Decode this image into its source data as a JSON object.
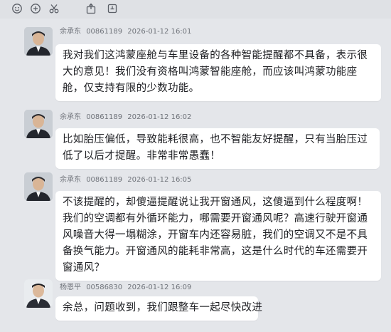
{
  "toolbar": {
    "icons": [
      "emoji-icon",
      "zoom-icon",
      "scissors-icon",
      "share-icon",
      "history-icon"
    ]
  },
  "messages": [
    {
      "sender": "余承东",
      "id": "00861189",
      "time": "2026-01-12 16:01",
      "lines": [
        "我对我们这鸿蒙座舱与车里设备的各种智能提醒都不具备，表示很",
        "大的意见！我们没有资格叫鸿蒙智能座舱，而应该叫鸿蒙功能座",
        "舱，仅支持有限的少数功能。"
      ]
    },
    {
      "sender": "余承东",
      "id": "00861189",
      "time": "2026-01-12 16:02",
      "lines": [
        "比如胎压偏低，导致能耗很高，也不智能友好提醒，只有当胎压过",
        "低了以后才提醒。非常非常愚蠢！"
      ]
    },
    {
      "sender": "余承东",
      "id": "00861189",
      "time": "2026-01-12 16:05",
      "lines": [
        "不该提醒的，却傻逼提醒说让我开窗通风，这傻逼到什么程度啊！",
        "我们的空调都有外循环能力，哪需要开窗通风呢？高速行驶开窗通",
        "风噪音大得一塌糊涂，开窗车内还容易脏，我们的空调又不是不具",
        "备换气能力。开窗通风的能耗非常高，这是什么时代的车还需要开",
        "窗通风？"
      ]
    },
    {
      "sender": "杨恩平",
      "id": "00586830",
      "time": "2026-01-12 16:09",
      "lines": [
        "余总，问题收到，我们跟整车一起尽快改进"
      ]
    }
  ]
}
